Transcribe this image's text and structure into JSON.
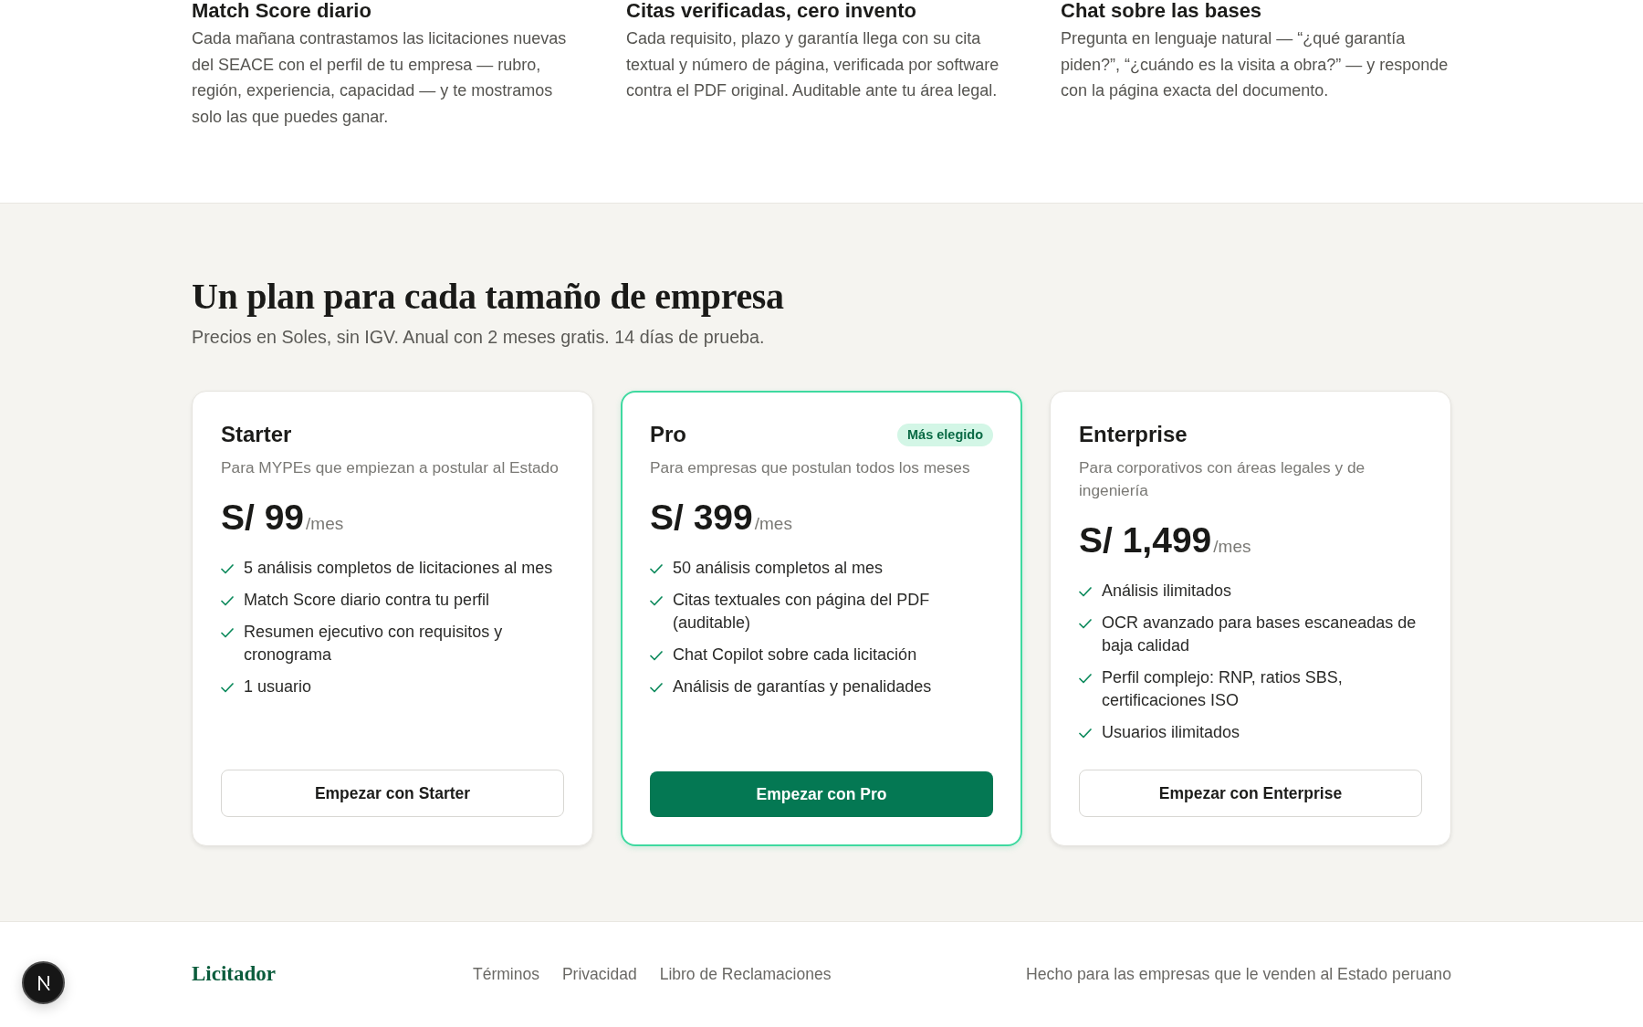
{
  "features": [
    {
      "title": "Match Score diario",
      "description": "Cada mañana contrastamos las licitaciones nuevas del SEACE con el perfil de tu empresa — rubro, región, experiencia, capacidad — y te mostramos solo las que puedes ganar."
    },
    {
      "title": "Citas verificadas, cero invento",
      "description": "Cada requisito, plazo y garantía llega con su cita textual y número de página, verificada por software contra el PDF original. Auditable ante tu área legal."
    },
    {
      "title": "Chat sobre las bases",
      "description": "Pregunta en lenguaje natural — “¿qué garantía piden?”, “¿cuándo es la visita a obra?” — y responde con la página exacta del documento."
    }
  ],
  "pricing": {
    "title": "Un plan para cada tamaño de empresa",
    "subtitle": "Precios en Soles, sin IGV. Anual con 2 meses gratis. 14 días de prueba.",
    "plans": [
      {
        "name": "Starter",
        "featured": false,
        "description": "Para MYPEs que empiezan a postular al Estado",
        "price": "S/ 99",
        "period": "/mes",
        "features": [
          "5 análisis completos de licitaciones al mes",
          "Match Score diario contra tu perfil",
          "Resumen ejecutivo con requisitos y cronograma",
          "1 usuario"
        ],
        "cta": "Empezar con Starter"
      },
      {
        "name": "Pro",
        "featured": true,
        "badge": "Más elegido",
        "description": "Para empresas que postulan todos los meses",
        "price": "S/ 399",
        "period": "/mes",
        "features": [
          "50 análisis completos al mes",
          "Citas textuales con página del PDF (auditable)",
          "Chat Copilot sobre cada licitación",
          "Análisis de garantías y penalidades"
        ],
        "cta": "Empezar con Pro"
      },
      {
        "name": "Enterprise",
        "featured": false,
        "description": "Para corporativos con áreas legales y de ingeniería",
        "price": "S/ 1,499",
        "period": "/mes",
        "features": [
          "Análisis ilimitados",
          "OCR avanzado para bases escaneadas de baja calidad",
          "Perfil complejo: RNP, ratios SBS, certificaciones ISO",
          "Usuarios ilimitados"
        ],
        "cta": "Empezar con Enterprise"
      }
    ]
  },
  "footer": {
    "logo": "Licitador",
    "links": [
      "Términos",
      "Privacidad",
      "Libro de Reclamaciones"
    ],
    "tagline": "Hecho para las empresas que le venden al Estado peruano"
  }
}
